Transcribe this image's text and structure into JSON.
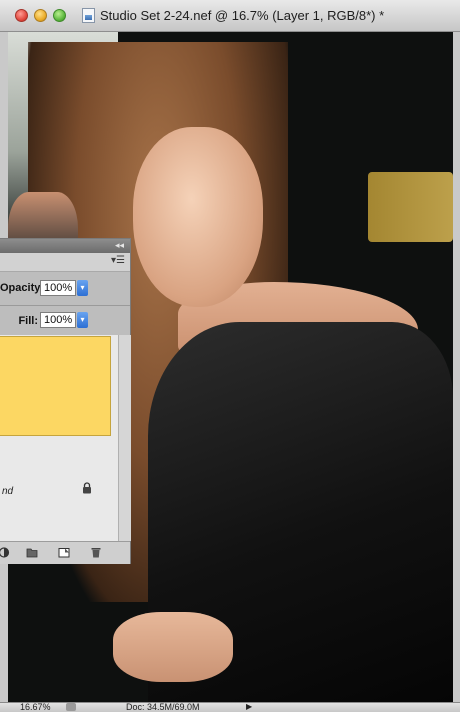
{
  "window": {
    "title": "Studio Set 2-24.nef @ 16.7% (Layer 1, RGB/8*) *"
  },
  "layers_panel": {
    "opacity_label": "Opacity:",
    "opacity_value": "100%",
    "fill_label": "Fill:",
    "fill_value": "100%",
    "layer_name_fragment": "nd",
    "layer_color": "#fcd763"
  },
  "status_bar": {
    "zoom": "16.67%",
    "doc_info": "Doc: 34.5M/69.0M"
  },
  "colors": {
    "accent_stepper": "#2d6fd4",
    "titlebar": "#d6d6d6"
  }
}
